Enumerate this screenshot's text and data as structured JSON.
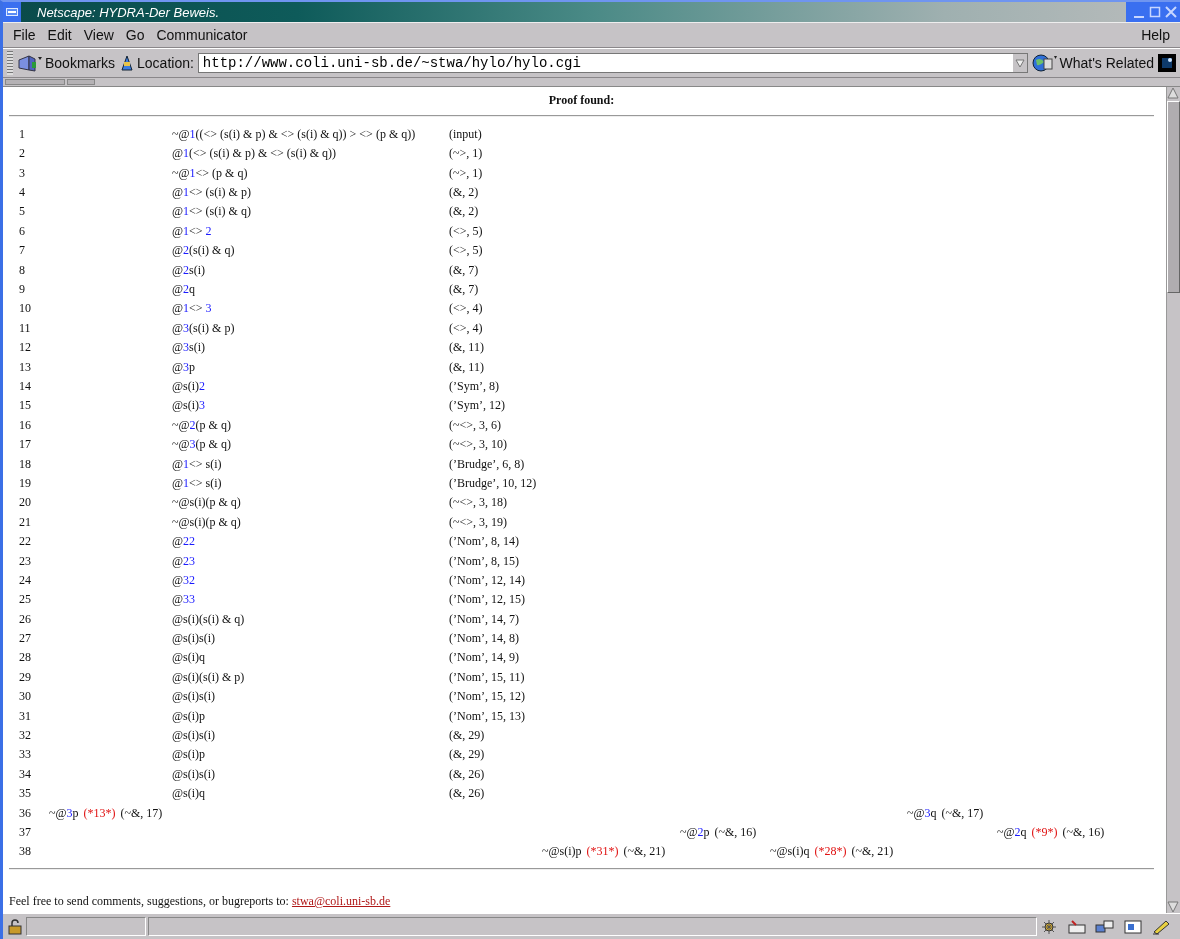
{
  "window": {
    "title": "Netscape: HYDRA-Der Beweis."
  },
  "menu": [
    {
      "label": "File"
    },
    {
      "label": "Edit"
    },
    {
      "label": "View"
    },
    {
      "label": "Go"
    },
    {
      "label": "Communicator"
    }
  ],
  "help_menu": "Help",
  "toolbar": {
    "bookmarks": "Bookmarks",
    "location_label": "Location:",
    "url": "http://www.coli.uni-sb.de/~stwa/hylo/hylo.cgi",
    "whats_related": "What's Related"
  },
  "page": {
    "heading": "Proof found:",
    "proof": [
      {
        "number": "1",
        "formula": [
          {
            "text": "~@",
            "kind": "plain"
          },
          {
            "text": "1",
            "kind": "nominal"
          },
          {
            "text": "((<> (s(i) & p) & <> (s(i) & q)) > <> (p & q))",
            "kind": "plain"
          }
        ],
        "justification": "(input)"
      },
      {
        "number": "2",
        "formula": [
          {
            "text": "@",
            "kind": "plain"
          },
          {
            "text": "1",
            "kind": "nominal"
          },
          {
            "text": "(<> (s(i) & p) & <> (s(i) & q))",
            "kind": "plain"
          }
        ],
        "justification": "(~>, 1)"
      },
      {
        "number": "3",
        "formula": [
          {
            "text": "~@",
            "kind": "plain"
          },
          {
            "text": "1",
            "kind": "nominal"
          },
          {
            "text": "<> (p & q)",
            "kind": "plain"
          }
        ],
        "justification": "(~>, 1)"
      },
      {
        "number": "4",
        "formula": [
          {
            "text": "@",
            "kind": "plain"
          },
          {
            "text": "1",
            "kind": "nominal"
          },
          {
            "text": "<> (s(i) & p)",
            "kind": "plain"
          }
        ],
        "justification": "(&, 2)"
      },
      {
        "number": "5",
        "formula": [
          {
            "text": "@",
            "kind": "plain"
          },
          {
            "text": "1",
            "kind": "nominal"
          },
          {
            "text": "<> (s(i) & q)",
            "kind": "plain"
          }
        ],
        "justification": "(&, 2)"
      },
      {
        "number": "6",
        "formula": [
          {
            "text": "@",
            "kind": "plain"
          },
          {
            "text": "1",
            "kind": "nominal"
          },
          {
            "text": "<> ",
            "kind": "plain"
          },
          {
            "text": "2",
            "kind": "nominal"
          }
        ],
        "justification": "(<>, 5)"
      },
      {
        "number": "7",
        "formula": [
          {
            "text": "@",
            "kind": "plain"
          },
          {
            "text": "2",
            "kind": "nominal"
          },
          {
            "text": "(s(i) & q)",
            "kind": "plain"
          }
        ],
        "justification": "(<>, 5)"
      },
      {
        "number": "8",
        "formula": [
          {
            "text": "@",
            "kind": "plain"
          },
          {
            "text": "2",
            "kind": "nominal"
          },
          {
            "text": "s(i)",
            "kind": "plain"
          }
        ],
        "justification": "(&, 7)"
      },
      {
        "number": "9",
        "formula": [
          {
            "text": "@",
            "kind": "plain"
          },
          {
            "text": "2",
            "kind": "nominal"
          },
          {
            "text": "q",
            "kind": "plain"
          }
        ],
        "justification": "(&, 7)"
      },
      {
        "number": "10",
        "formula": [
          {
            "text": "@",
            "kind": "plain"
          },
          {
            "text": "1",
            "kind": "nominal"
          },
          {
            "text": "<> ",
            "kind": "plain"
          },
          {
            "text": "3",
            "kind": "nominal"
          }
        ],
        "justification": "(<>, 4)"
      },
      {
        "number": "11",
        "formula": [
          {
            "text": "@",
            "kind": "plain"
          },
          {
            "text": "3",
            "kind": "nominal"
          },
          {
            "text": "(s(i) & p)",
            "kind": "plain"
          }
        ],
        "justification": "(<>, 4)"
      },
      {
        "number": "12",
        "formula": [
          {
            "text": "@",
            "kind": "plain"
          },
          {
            "text": "3",
            "kind": "nominal"
          },
          {
            "text": "s(i)",
            "kind": "plain"
          }
        ],
        "justification": "(&, 11)"
      },
      {
        "number": "13",
        "formula": [
          {
            "text": "@",
            "kind": "plain"
          },
          {
            "text": "3",
            "kind": "nominal"
          },
          {
            "text": "p",
            "kind": "plain"
          }
        ],
        "justification": "(&, 11)"
      },
      {
        "number": "14",
        "formula": [
          {
            "text": "@s(i)",
            "kind": "plain"
          },
          {
            "text": "2",
            "kind": "nominal"
          }
        ],
        "justification": "(’Sym’, 8)"
      },
      {
        "number": "15",
        "formula": [
          {
            "text": "@s(i)",
            "kind": "plain"
          },
          {
            "text": "3",
            "kind": "nominal"
          }
        ],
        "justification": "(’Sym’, 12)"
      },
      {
        "number": "16",
        "formula": [
          {
            "text": "~@",
            "kind": "plain"
          },
          {
            "text": "2",
            "kind": "nominal"
          },
          {
            "text": "(p & q)",
            "kind": "plain"
          }
        ],
        "justification": "(~<>, 3, 6)"
      },
      {
        "number": "17",
        "formula": [
          {
            "text": "~@",
            "kind": "plain"
          },
          {
            "text": "3",
            "kind": "nominal"
          },
          {
            "text": "(p & q)",
            "kind": "plain"
          }
        ],
        "justification": "(~<>, 3, 10)"
      },
      {
        "number": "18",
        "formula": [
          {
            "text": "@",
            "kind": "plain"
          },
          {
            "text": "1",
            "kind": "nominal"
          },
          {
            "text": "<> s(i)",
            "kind": "plain"
          }
        ],
        "justification": "(’Brudge’, 6, 8)"
      },
      {
        "number": "19",
        "formula": [
          {
            "text": "@",
            "kind": "plain"
          },
          {
            "text": "1",
            "kind": "nominal"
          },
          {
            "text": "<> s(i)",
            "kind": "plain"
          }
        ],
        "justification": "(’Brudge’, 10, 12)"
      },
      {
        "number": "20",
        "formula": [
          {
            "text": "~@s(i)(p & q)",
            "kind": "plain"
          }
        ],
        "justification": "(~<>, 3, 18)"
      },
      {
        "number": "21",
        "formula": [
          {
            "text": "~@s(i)(p & q)",
            "kind": "plain"
          }
        ],
        "justification": "(~<>, 3, 19)"
      },
      {
        "number": "22",
        "formula": [
          {
            "text": "@",
            "kind": "plain"
          },
          {
            "text": "22",
            "kind": "nominal"
          }
        ],
        "justification": "(’Nom’, 8, 14)"
      },
      {
        "number": "23",
        "formula": [
          {
            "text": "@",
            "kind": "plain"
          },
          {
            "text": "23",
            "kind": "nominal"
          }
        ],
        "justification": "(’Nom’, 8, 15)"
      },
      {
        "number": "24",
        "formula": [
          {
            "text": "@",
            "kind": "plain"
          },
          {
            "text": "32",
            "kind": "nominal"
          }
        ],
        "justification": "(’Nom’, 12, 14)"
      },
      {
        "number": "25",
        "formula": [
          {
            "text": "@",
            "kind": "plain"
          },
          {
            "text": "33",
            "kind": "nominal"
          }
        ],
        "justification": "(’Nom’, 12, 15)"
      },
      {
        "number": "26",
        "formula": [
          {
            "text": "@s(i)(s(i) & q)",
            "kind": "plain"
          }
        ],
        "justification": "(’Nom’, 14, 7)"
      },
      {
        "number": "27",
        "formula": [
          {
            "text": "@s(i)s(i)",
            "kind": "plain"
          }
        ],
        "justification": "(’Nom’, 14, 8)"
      },
      {
        "number": "28",
        "formula": [
          {
            "text": "@s(i)q",
            "kind": "plain"
          }
        ],
        "justification": "(’Nom’, 14, 9)"
      },
      {
        "number": "29",
        "formula": [
          {
            "text": "@s(i)(s(i) & p)",
            "kind": "plain"
          }
        ],
        "justification": "(’Nom’, 15, 11)"
      },
      {
        "number": "30",
        "formula": [
          {
            "text": "@s(i)s(i)",
            "kind": "plain"
          }
        ],
        "justification": "(’Nom’, 15, 12)"
      },
      {
        "number": "31",
        "formula": [
          {
            "text": "@s(i)p",
            "kind": "plain"
          }
        ],
        "justification": "(’Nom’, 15, 13)"
      },
      {
        "number": "32",
        "formula": [
          {
            "text": "@s(i)s(i)",
            "kind": "plain"
          }
        ],
        "justification": "(&, 29)"
      },
      {
        "number": "33",
        "formula": [
          {
            "text": "@s(i)p",
            "kind": "plain"
          }
        ],
        "justification": "(&, 29)"
      },
      {
        "number": "34",
        "formula": [
          {
            "text": "@s(i)s(i)",
            "kind": "plain"
          }
        ],
        "justification": "(&, 26)"
      },
      {
        "number": "35",
        "formula": [
          {
            "text": "@s(i)q",
            "kind": "plain"
          }
        ],
        "justification": "(&, 26)"
      }
    ],
    "branches": [
      {
        "number": "36",
        "entries": [
          {
            "formula": [
              {
                "text": "~@",
                "kind": "plain"
              },
              {
                "text": "3",
                "kind": "nominal"
              },
              {
                "text": "p",
                "kind": "plain"
              }
            ],
            "closure": "(*13*)",
            "justification": "(~&, 17)"
          },
          {
            "formula": [
              {
                "text": "~@",
                "kind": "plain"
              },
              {
                "text": "3",
                "kind": "nominal"
              },
              {
                "text": "q",
                "kind": "plain"
              }
            ],
            "justification": "(~&, 17)"
          }
        ]
      },
      {
        "number": "37",
        "entries": [
          {
            "formula": [
              {
                "text": "~@",
                "kind": "plain"
              },
              {
                "text": "2",
                "kind": "nominal"
              },
              {
                "text": "p",
                "kind": "plain"
              }
            ],
            "justification": "(~&, 16)"
          },
          {
            "formula": [
              {
                "text": "~@",
                "kind": "plain"
              },
              {
                "text": "2",
                "kind": "nominal"
              },
              {
                "text": "q",
                "kind": "plain"
              }
            ],
            "closure": "(*9*)",
            "justification": "(~&, 16)"
          }
        ]
      },
      {
        "number": "38",
        "entries": [
          {
            "formula": [
              {
                "text": "~@s(i)p",
                "kind": "plain"
              }
            ],
            "closure": "(*31*)",
            "justification": "(~&, 21)"
          },
          {
            "formula": [
              {
                "text": "~@s(i)q",
                "kind": "plain"
              }
            ],
            "closure": "(*28*)",
            "justification": "(~&, 21)"
          }
        ]
      }
    ],
    "footer": {
      "text": "Feel free to send comments, suggestions, or bugreports to:",
      "link": "stwa@coli.uni-sb.de"
    }
  }
}
